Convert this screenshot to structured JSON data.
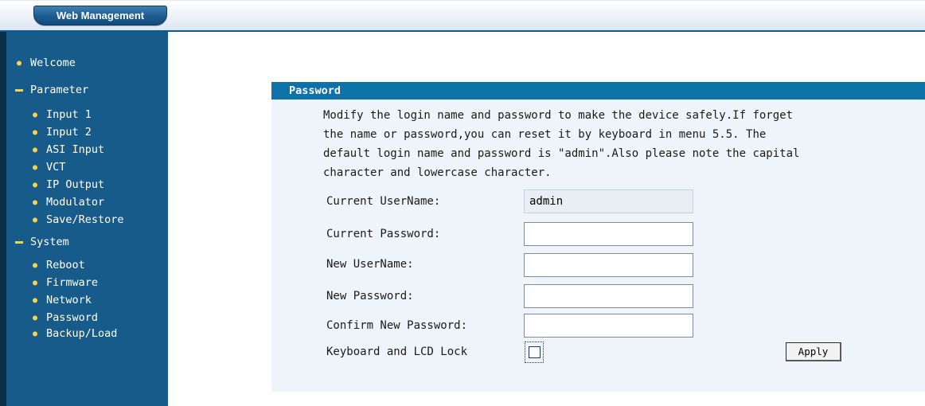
{
  "header": {
    "brand": "Web Management"
  },
  "sidebar": {
    "items": [
      {
        "label": "Welcome",
        "type": "link"
      },
      {
        "label": "Parameter",
        "type": "section"
      },
      {
        "label": "Input 1",
        "type": "link"
      },
      {
        "label": "Input 2",
        "type": "link"
      },
      {
        "label": "ASI Input",
        "type": "link"
      },
      {
        "label": "VCT",
        "type": "link"
      },
      {
        "label": "IP Output",
        "type": "link"
      },
      {
        "label": "Modulator",
        "type": "link"
      },
      {
        "label": "Save/Restore",
        "type": "link"
      },
      {
        "label": "System",
        "type": "section"
      },
      {
        "label": "Reboot",
        "type": "link"
      },
      {
        "label": "Firmware",
        "type": "link"
      },
      {
        "label": "Network",
        "type": "link"
      },
      {
        "label": "Password",
        "type": "link"
      },
      {
        "label": "Backup/Load",
        "type": "link"
      }
    ]
  },
  "panel": {
    "title": "Password",
    "description": "Modify the login name and password to make the device safely.If forget\nthe name or password,you can reset it by keyboard in menu 5.5. The\ndefault login name and password is \"admin\".Also please note the capital\ncharacter and lowercase character.",
    "fields": {
      "current_username_label": "Current UserName:",
      "current_username_value": "admin",
      "current_password_label": "Current Password:",
      "current_password_value": "",
      "new_username_label": "New UserName:",
      "new_username_value": "",
      "new_password_label": "New Password:",
      "new_password_value": "",
      "confirm_password_label": "Confirm New Password:",
      "confirm_password_value": "",
      "lock_label": "Keyboard and LCD Lock",
      "lock_checked": false
    },
    "apply_label": "Apply"
  },
  "colors": {
    "sidebar_bg": "#175b8a",
    "bullet": "#f5d34a",
    "panel_header_bg": "#0c72a8",
    "panel_bg": "#eef4fa"
  }
}
